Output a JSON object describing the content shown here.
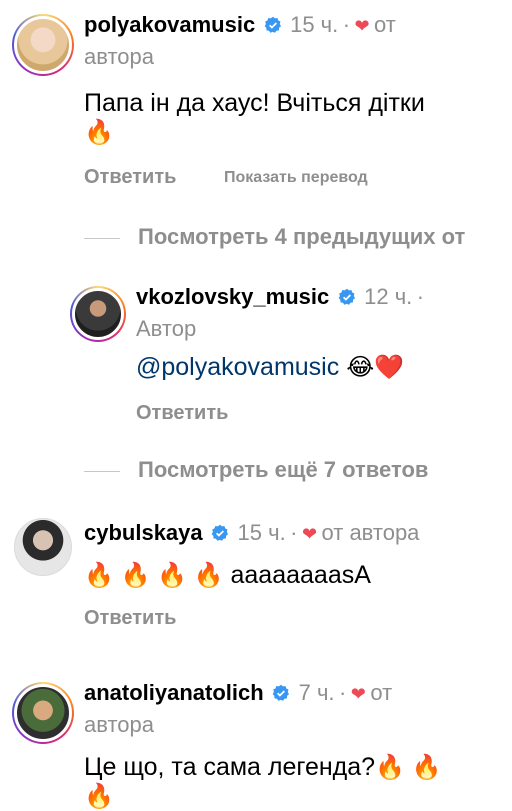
{
  "comments": [
    {
      "username": "polyakovamusic",
      "time": "15 ч.",
      "sep": "·",
      "author_tag_1": "от",
      "author_tag_2": "автора",
      "text": "Папа ін да хаус! Вчіться дітки",
      "emoji_line": "🔥",
      "reply_label": "Ответить",
      "translate_label": "Показать перевод"
    },
    {
      "username": "vkozlovsky_music",
      "time": "12 ч.",
      "sep": "·",
      "author_tag": "Автор",
      "mention": "@polyakovamusic",
      "emoji": "😂❤️",
      "reply_label": "Ответить"
    },
    {
      "username": "cybulskaya",
      "time": "15 ч.",
      "sep": "·",
      "author_tag": "от автора",
      "emoji": "🔥 🔥 🔥 🔥",
      "text": "ааааааааsА",
      "reply_label": "Ответить"
    },
    {
      "username": "anatoliyanatolich",
      "time": "7 ч.",
      "sep": "·",
      "author_tag_1": "от",
      "author_tag_2": "автора",
      "text": "Це що, та сама легенда?",
      "emoji": "🔥 🔥",
      "emoji_line": "🔥"
    }
  ],
  "view_previous": "Посмотреть 4 предыдущих от",
  "view_more_replies": "Посмотреть ещё 7 ответов",
  "colors": {
    "verified": "#3897f0",
    "heart": "#ed4956",
    "mention": "#00376b",
    "muted": "#8e8e8e"
  },
  "icons": [
    "verified-badge-icon",
    "heart-icon"
  ]
}
